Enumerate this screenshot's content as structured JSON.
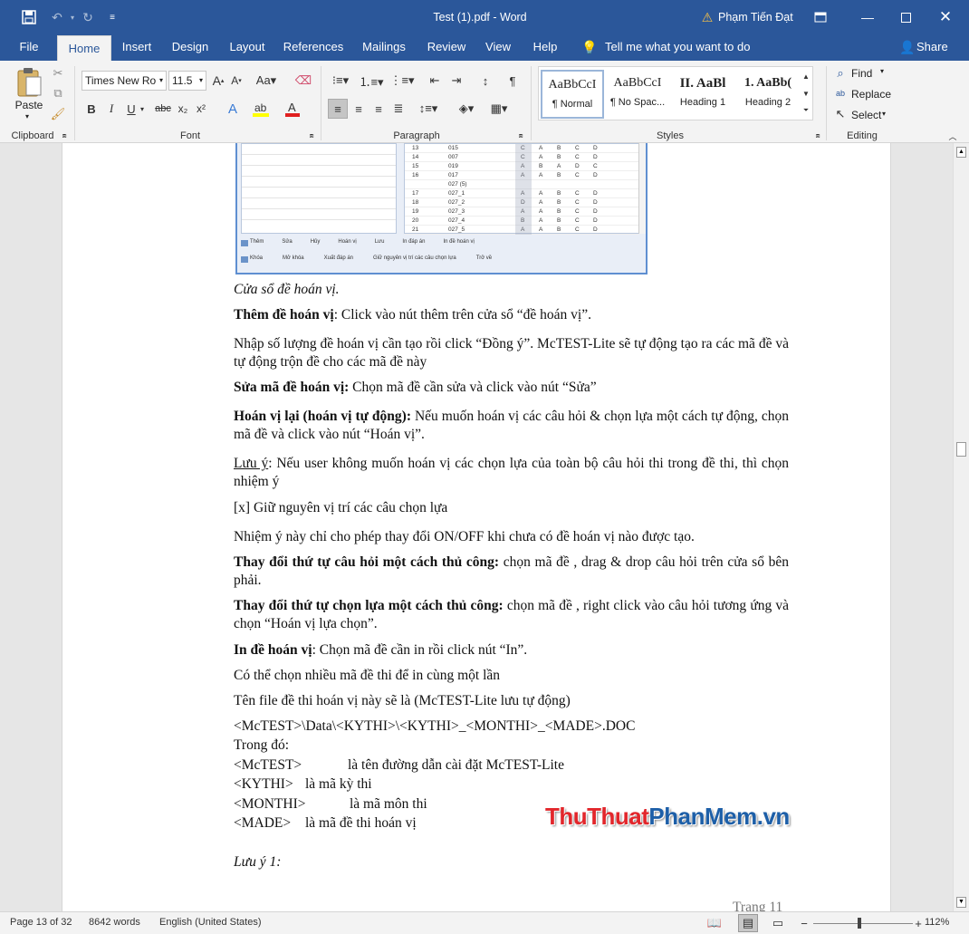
{
  "titlebar": {
    "title": "Test (1).pdf - Word",
    "user": "Phạm Tiến Đạt"
  },
  "tabs": [
    "File",
    "Home",
    "Insert",
    "Design",
    "Layout",
    "References",
    "Mailings",
    "Review",
    "View",
    "Help"
  ],
  "tell_me": "Tell me what you want to do",
  "share": "Share",
  "ribbon": {
    "clipboard": {
      "paste": "Paste",
      "label": "Clipboard"
    },
    "font": {
      "name": "Times New Ro",
      "size": "11.5",
      "label": "Font",
      "bold": "B",
      "italic": "I",
      "underline": "U",
      "strike": "abc",
      "sub": "x₂",
      "sup": "x²"
    },
    "paragraph": {
      "label": "Paragraph"
    },
    "styles": {
      "label": "Styles",
      "items": [
        {
          "preview": "AaBbCcI",
          "name": "¶ Normal"
        },
        {
          "preview": "AaBbCcI",
          "name": "¶ No Spac..."
        },
        {
          "preview": "II. AaBl",
          "name": "Heading 1"
        },
        {
          "preview": "1. AaBb(",
          "name": "Heading 2"
        }
      ]
    },
    "editing": {
      "label": "Editing",
      "find": "Find",
      "replace": "Replace",
      "select": "Select"
    }
  },
  "embedded": {
    "rows": [
      {
        "n": "13",
        "code": "015",
        "k": "C",
        "a": "A",
        "b": "B",
        "c": "C",
        "d": "D"
      },
      {
        "n": "14",
        "code": "007",
        "k": "C",
        "a": "A",
        "b": "B",
        "c": "C",
        "d": "D"
      },
      {
        "n": "15",
        "code": "019",
        "k": "A",
        "a": "B",
        "b": "A",
        "c": "D",
        "d": "C"
      },
      {
        "n": "16",
        "code": "017",
        "k": "A",
        "a": "A",
        "b": "B",
        "c": "C",
        "d": "D"
      },
      {
        "n": "",
        "code": "027 (5)",
        "k": "",
        "a": "",
        "b": "",
        "c": "",
        "d": ""
      },
      {
        "n": "17",
        "code": "027_1",
        "k": "A",
        "a": "A",
        "b": "B",
        "c": "C",
        "d": "D"
      },
      {
        "n": "18",
        "code": "027_2",
        "k": "D",
        "a": "A",
        "b": "B",
        "c": "C",
        "d": "D"
      },
      {
        "n": "19",
        "code": "027_3",
        "k": "A",
        "a": "A",
        "b": "B",
        "c": "C",
        "d": "D"
      },
      {
        "n": "20",
        "code": "027_4",
        "k": "B",
        "a": "A",
        "b": "B",
        "c": "C",
        "d": "D"
      },
      {
        "n": "21",
        "code": "027_5",
        "k": "A",
        "a": "A",
        "b": "B",
        "c": "C",
        "d": "D"
      }
    ],
    "buttons1": [
      "Thêm",
      "Sửa",
      "Hủy",
      "Hoán vị",
      "Lưu",
      "In đáp án",
      "In đề hoán vị"
    ],
    "buttons2": [
      "Khóa",
      "Mở khóa",
      "Xuất đáp án",
      "Giữ nguyên vị trí các câu chọn lựa",
      "Trở về"
    ]
  },
  "doc": {
    "caption": "Cửa sổ đề hoán vị.",
    "p1_bold": "Thêm đề hoán vị",
    "p1_rest": ":  Click vào nút thêm trên cửa sổ “đề hoán vị”.",
    "p2": "Nhập số lượng đề hoán vị cần tạo rồi click “Đồng ý”. McTEST-Lite sẽ tự động tạo ra các mã đề và tự động trộn đề cho các mã đề này",
    "p3_bold": "Sửa mã đề hoán vị:",
    "p3_rest": " Chọn mã đề cần sửa và click vào nút “Sửa”",
    "p4_bold": "Hoán vị lại (hoán vị tự động):",
    "p4_rest": " Nếu muốn hoán vị các câu hỏi & chọn lựa một cách tự động, chọn mã đề và click vào nút  “Hoán vị”.",
    "p5_u": "Lưu ý",
    "p5_rest": ": Nếu user không muốn hoán vị các chọn lựa của toàn bộ câu hỏi thi trong đề thi, thì chọn nhiệm ý",
    "p6": "[x] Giữ nguyên vị trí các câu chọn lựa",
    "p7": "Nhiệm ý này chỉ cho phép thay đổi ON/OFF khi chưa có đề hoán vị nào được tạo.",
    "p8_bold": "Thay đổi thứ tự câu hỏi một cách thủ công:",
    "p8_rest": " chọn mã đề , drag & drop câu hỏi trên cửa sổ bên phải.",
    "p9_bold": "Thay đổi thứ tự chọn lựa một cách thủ công:",
    "p9_rest": " chọn mã đề , right click vào câu hỏi tương ứng và chọn “Hoán vị lựa chọn”.",
    "p10_bold": "In đề hoán vị",
    "p10_rest": ": Chọn mã đề cần in rồi click nút “In”.",
    "p11": "Có thể chọn nhiều mã đề thi để in cùng một lần",
    "p12": "Tên file đề thi hoán vị này sẽ là (McTEST-Lite lưu tự động)",
    "p13": "<McTEST>\\Data\\<KYTHI>\\<KYTHI>_<MONTHI>_<MADE>.DOC",
    "p14": "Trong đó:",
    "l1_key": "<McTEST>",
    "l1_val": "là tên đường dẫn cài đặt McTEST-Lite",
    "l2_key": "<KYTHI>",
    "l2_val": "là mã kỳ thi",
    "l3_key": "<MONTHI>",
    "l3_val": "là mã môn thi",
    "l4_key": "<MADE>",
    "l4_val": "là mã đề thi hoán vị",
    "note": "Lưu ý 1:",
    "footer": "Trang 11"
  },
  "watermark": {
    "part1": "ThuThuat",
    "part2": "PhanMem",
    "part3": ".vn"
  },
  "status": {
    "page": "Page 13 of 32",
    "words": "8642 words",
    "lang": "English (United States)",
    "zoom": "112%"
  },
  "colors": {
    "accent": "#2b579a",
    "ribbon": "#f3f3f3"
  }
}
